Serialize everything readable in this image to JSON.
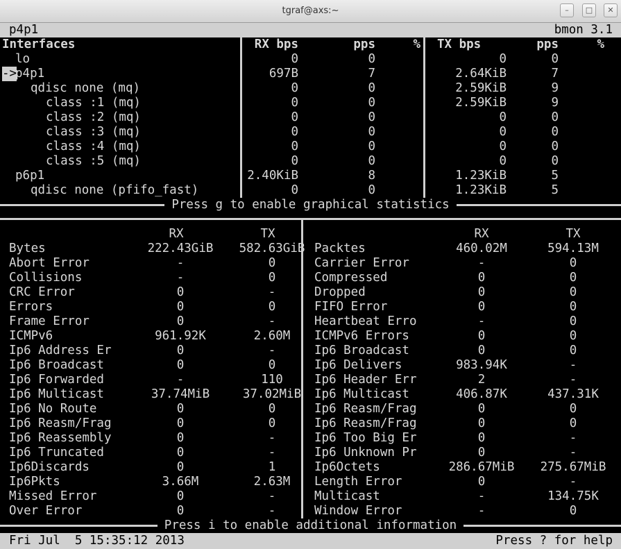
{
  "window": {
    "title": "tgraf@axs:~"
  },
  "header": {
    "left": "p4p1",
    "right": "bmon 3.1"
  },
  "interfaces": {
    "columns": [
      "Interfaces",
      "RX bps",
      "pps",
      "%",
      "TX bps",
      "pps",
      "%"
    ],
    "rows": [
      {
        "marker": "",
        "name": "lo",
        "rx_bps": "0",
        "rx_pps": "0",
        "tx_bps": "0",
        "tx_pps": "0"
      },
      {
        "marker": "->",
        "name": "p4p1",
        "rx_bps": "697B",
        "rx_pps": "7",
        "tx_bps": "2.64KiB",
        "tx_pps": "7"
      },
      {
        "marker": "",
        "name": "qdisc none (mq)",
        "rx_bps": "0",
        "rx_pps": "0",
        "tx_bps": "2.59KiB",
        "tx_pps": "9"
      },
      {
        "marker": "",
        "name": "class :1 (mq)",
        "rx_bps": "0",
        "rx_pps": "0",
        "tx_bps": "2.59KiB",
        "tx_pps": "9"
      },
      {
        "marker": "",
        "name": "class :2 (mq)",
        "rx_bps": "0",
        "rx_pps": "0",
        "tx_bps": "0",
        "tx_pps": "0"
      },
      {
        "marker": "",
        "name": "class :3 (mq)",
        "rx_bps": "0",
        "rx_pps": "0",
        "tx_bps": "0",
        "tx_pps": "0"
      },
      {
        "marker": "",
        "name": "class :4 (mq)",
        "rx_bps": "0",
        "rx_pps": "0",
        "tx_bps": "0",
        "tx_pps": "0"
      },
      {
        "marker": "",
        "name": "class :5 (mq)",
        "rx_bps": "0",
        "rx_pps": "0",
        "tx_bps": "0",
        "tx_pps": "0"
      },
      {
        "marker": "",
        "name": "p6p1",
        "rx_bps": "2.40KiB",
        "rx_pps": "8",
        "tx_bps": "1.23KiB",
        "tx_pps": "5"
      },
      {
        "marker": "",
        "name": "qdisc none (pfifo_fast)",
        "rx_bps": "0",
        "rx_pps": "0",
        "tx_bps": "1.23KiB",
        "tx_pps": "5"
      }
    ]
  },
  "graph_hint": "Press g to enable graphical statistics",
  "details": {
    "headers": {
      "rx": "RX",
      "tx": "TX"
    },
    "left": [
      {
        "label": "Bytes",
        "rx": "222.43GiB",
        "tx": "582.63GiB"
      },
      {
        "label": "Abort Error",
        "rx": "-",
        "tx": "0"
      },
      {
        "label": "Collisions",
        "rx": "-",
        "tx": "0"
      },
      {
        "label": "CRC Error",
        "rx": "0",
        "tx": "-"
      },
      {
        "label": "Errors",
        "rx": "0",
        "tx": "0"
      },
      {
        "label": "Frame Error",
        "rx": "0",
        "tx": "-"
      },
      {
        "label": "ICMPv6",
        "rx": "961.92K",
        "tx": "2.60M"
      },
      {
        "label": "Ip6 Address Er",
        "rx": "0",
        "tx": "-"
      },
      {
        "label": "Ip6 Broadcast",
        "rx": "0",
        "tx": "0"
      },
      {
        "label": "Ip6 Forwarded",
        "rx": "-",
        "tx": "110"
      },
      {
        "label": "Ip6 Multicast",
        "rx": "37.74MiB",
        "tx": "37.02MiB"
      },
      {
        "label": "Ip6 No Route",
        "rx": "0",
        "tx": "0"
      },
      {
        "label": "Ip6 Reasm/Frag",
        "rx": "0",
        "tx": "0"
      },
      {
        "label": "Ip6 Reassembly",
        "rx": "0",
        "tx": "-"
      },
      {
        "label": "Ip6 Truncated",
        "rx": "0",
        "tx": "-"
      },
      {
        "label": "Ip6Discards",
        "rx": "0",
        "tx": "1"
      },
      {
        "label": "Ip6Pkts",
        "rx": "3.66M",
        "tx": "2.63M"
      },
      {
        "label": "Missed Error",
        "rx": "0",
        "tx": "-"
      },
      {
        "label": "Over Error",
        "rx": "0",
        "tx": "-"
      }
    ],
    "right": [
      {
        "label": "Packtes",
        "rx": "460.02M",
        "tx": "594.13M"
      },
      {
        "label": "Carrier Error",
        "rx": "-",
        "tx": "0"
      },
      {
        "label": "Compressed",
        "rx": "0",
        "tx": "0"
      },
      {
        "label": "Dropped",
        "rx": "0",
        "tx": "0"
      },
      {
        "label": "FIFO Error",
        "rx": "0",
        "tx": "0"
      },
      {
        "label": "Heartbeat Erro",
        "rx": "-",
        "tx": "0"
      },
      {
        "label": "ICMPv6 Errors",
        "rx": "0",
        "tx": "0"
      },
      {
        "label": "Ip6 Broadcast",
        "rx": "0",
        "tx": "0"
      },
      {
        "label": "Ip6 Delivers",
        "rx": "983.94K",
        "tx": "-"
      },
      {
        "label": "Ip6 Header Err",
        "rx": "2",
        "tx": "-"
      },
      {
        "label": "Ip6 Multicast",
        "rx": "406.87K",
        "tx": "437.31K"
      },
      {
        "label": "Ip6 Reasm/Frag",
        "rx": "0",
        "tx": "0"
      },
      {
        "label": "Ip6 Reasm/Frag",
        "rx": "0",
        "tx": "0"
      },
      {
        "label": "Ip6 Too Big Er",
        "rx": "0",
        "tx": "-"
      },
      {
        "label": "Ip6 Unknown Pr",
        "rx": "0",
        "tx": "-"
      },
      {
        "label": "Ip6Octets",
        "rx": "286.67MiB",
        "tx": "275.67MiB"
      },
      {
        "label": "Length Error",
        "rx": "0",
        "tx": "-"
      },
      {
        "label": "Multicast",
        "rx": "-",
        "tx": "134.75K"
      },
      {
        "label": "Window Error",
        "rx": "-",
        "tx": "0"
      }
    ]
  },
  "info_hint": "Press i to enable additional information",
  "status": {
    "left": "Fri Jul  5 15:35:12 2013",
    "right": "Press ? for help"
  }
}
